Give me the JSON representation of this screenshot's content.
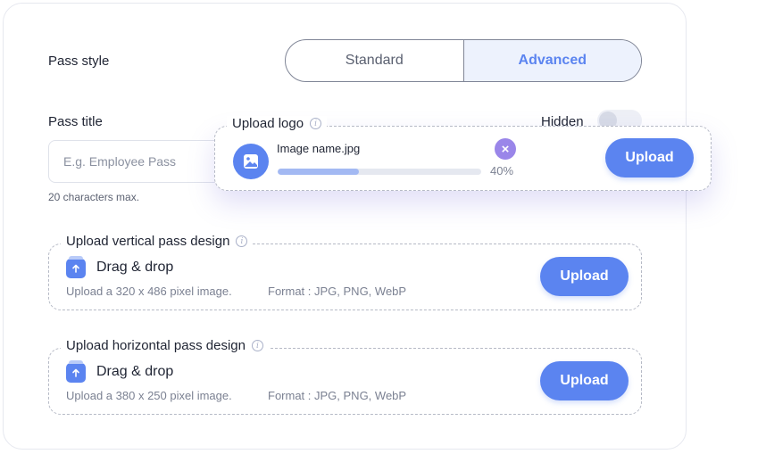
{
  "pass_style": {
    "label": "Pass style",
    "options": [
      "Standard",
      "Advanced"
    ],
    "selected": "Advanced"
  },
  "pass_title": {
    "label": "Pass title",
    "placeholder": "E.g. Employee Pass",
    "hint": "20 characters max."
  },
  "hidden_toggle": {
    "label": "Hidden",
    "on": false
  },
  "upload_logo": {
    "legend": "Upload logo",
    "file_name": "Image name.jpg",
    "progress_percent": 40,
    "progress_label": "40%",
    "button": "Upload"
  },
  "vertical_design": {
    "legend": "Upload vertical pass design",
    "drop_label": "Drag & drop",
    "size_note": "Upload a 320 x 486 pixel image.",
    "format_note": "Format : JPG, PNG, WebP",
    "button": "Upload"
  },
  "horizontal_design": {
    "legend": "Upload horizontal pass design",
    "drop_label": "Drag & drop",
    "size_note": "Upload a 380 x 250 pixel image.",
    "format_note": "Format : JPG, PNG, WebP",
    "button": "Upload"
  },
  "colors": {
    "accent": "#5b84f0",
    "accent_light": "#edf2fd",
    "close": "#9a86e9"
  },
  "icons": [
    "info-icon",
    "upload-arrow-icon",
    "image-icon",
    "close-icon"
  ]
}
